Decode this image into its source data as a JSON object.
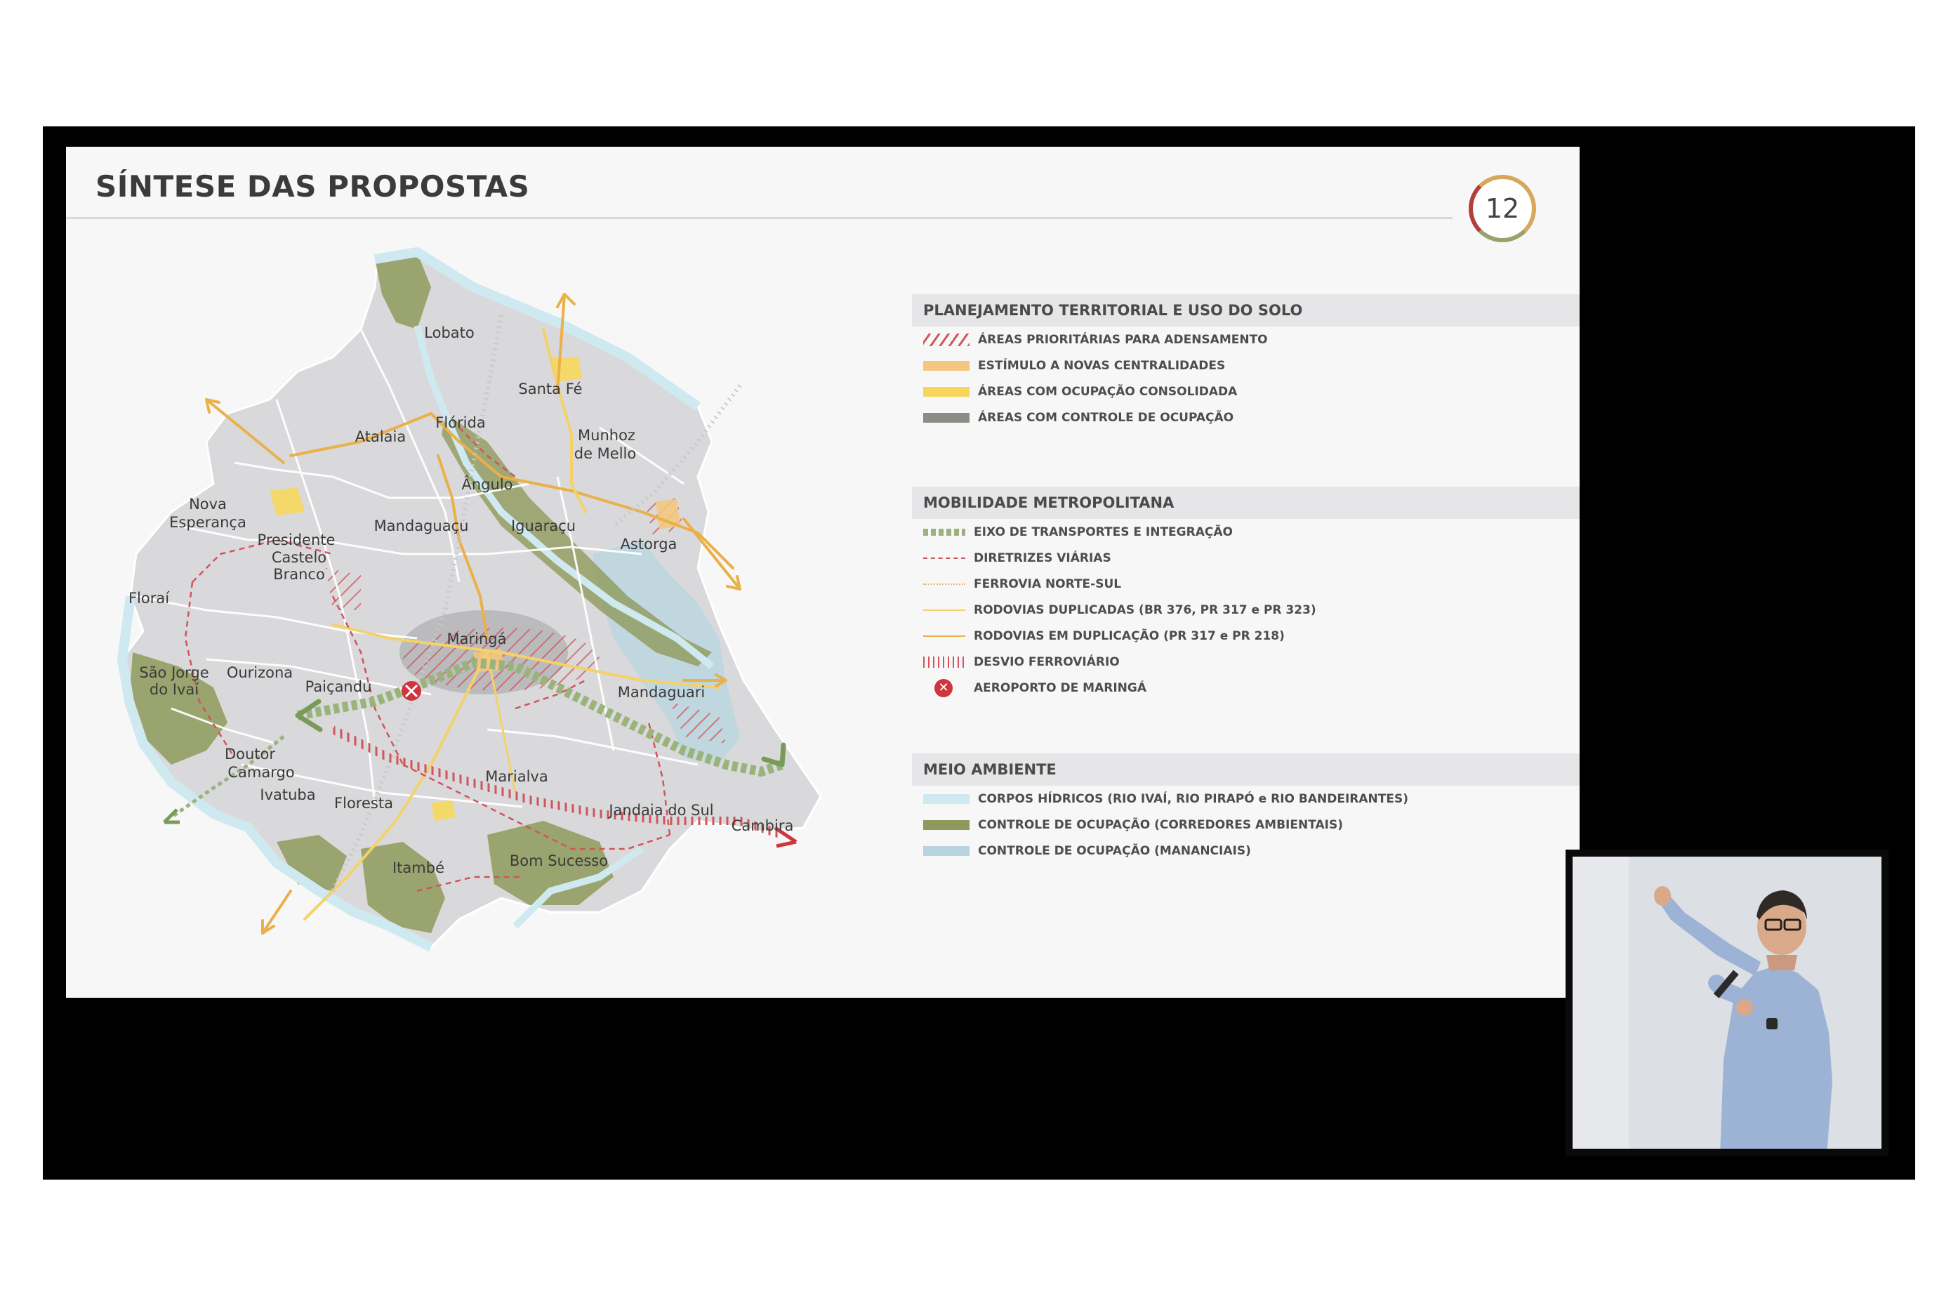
{
  "slide": {
    "title": "SÍNTESE DAS PROPOSTAS",
    "page_number": "12"
  },
  "map": {
    "places": [
      {
        "name": "Lobato",
        "pos": [
          546,
          272
        ]
      },
      {
        "name": "Santa Fé",
        "pos": [
          690,
          352
        ]
      },
      {
        "name": "Flórida",
        "pos": [
          562,
          400
        ]
      },
      {
        "name": "Atalaia",
        "pos": [
          448,
          420
        ]
      },
      {
        "name": "Munhoz",
        "pos": [
          770,
          418
        ]
      },
      {
        "name": "de Mello",
        "pos": [
          768,
          444
        ]
      },
      {
        "name": "Ângulo",
        "pos": [
          600,
          488
        ]
      },
      {
        "name": "Nova",
        "pos": [
          202,
          516
        ]
      },
      {
        "name": "Esperança",
        "pos": [
          202,
          542
        ]
      },
      {
        "name": "Mandaguaçu",
        "pos": [
          506,
          547
        ]
      },
      {
        "name": "Iguaraçu",
        "pos": [
          680,
          547
        ]
      },
      {
        "name": "Presidente",
        "pos": [
          328,
          567
        ]
      },
      {
        "name": "Castelo",
        "pos": [
          332,
          592
        ]
      },
      {
        "name": "Branco",
        "pos": [
          332,
          616
        ]
      },
      {
        "name": "Astorga",
        "pos": [
          830,
          573
        ]
      },
      {
        "name": "Floraí",
        "pos": [
          118,
          650
        ]
      },
      {
        "name": "Maringá",
        "pos": [
          585,
          708
        ]
      },
      {
        "name": "São Jorge",
        "pos": [
          154,
          756
        ]
      },
      {
        "name": "do Ivaí",
        "pos": [
          154,
          780
        ]
      },
      {
        "name": "Ourizona",
        "pos": [
          276,
          756
        ]
      },
      {
        "name": "Paiçandu",
        "pos": [
          388,
          776
        ]
      },
      {
        "name": "Mandaguari",
        "pos": [
          848,
          784
        ]
      },
      {
        "name": "Doutor",
        "pos": [
          262,
          872
        ]
      },
      {
        "name": "Camargo",
        "pos": [
          278,
          898
        ]
      },
      {
        "name": "Marialva",
        "pos": [
          642,
          904
        ]
      },
      {
        "name": "Ivatuba",
        "pos": [
          316,
          930
        ]
      },
      {
        "name": "Floresta",
        "pos": [
          424,
          942
        ]
      },
      {
        "name": "Jandaia do Sul",
        "pos": [
          848,
          952
        ]
      },
      {
        "name": "Cambira",
        "pos": [
          992,
          974
        ]
      },
      {
        "name": "Bom Sucesso",
        "pos": [
          702,
          1024
        ]
      },
      {
        "name": "Itambé",
        "pos": [
          502,
          1034
        ]
      }
    ]
  },
  "legend": {
    "sections": [
      {
        "title": "PLANEJAMENTO TERRITORIAL E USO DO SOLO",
        "items": [
          {
            "label": "ÁREAS PRIORITÁRIAS PARA ADENSAMENTO",
            "swatch": "hatch",
            "color": "#d0555b"
          },
          {
            "label": "ESTÍMULO A NOVAS CENTRALIDADES",
            "swatch": "fill",
            "color": "#f3c77f"
          },
          {
            "label": "ÁREAS COM OCUPAÇÃO CONSOLIDADA",
            "swatch": "fill",
            "color": "#f6d75c"
          },
          {
            "label": "ÁREAS COM CONTROLE DE OCUPAÇÃO",
            "swatch": "fill",
            "color": "#8a8c86"
          }
        ]
      },
      {
        "title": "MOBILIDADE METROPOLITANA",
        "items": [
          {
            "label": "EIXO DE TRANSPORTES E INTEGRAÇÃO",
            "swatch": "dash-thick",
            "color": "#9ab37a"
          },
          {
            "label": "DIRETRIZES VIÁRIAS",
            "swatch": "dash-thin",
            "color": "#d0555b"
          },
          {
            "label": "FERROVIA NORTE-SUL",
            "swatch": "dot",
            "color": "#e8b37a"
          },
          {
            "label": "RODOVIAS DUPLICADAS (BR 376, PR 317 e PR 323)",
            "swatch": "line",
            "color": "#f3d26a"
          },
          {
            "label": "RODOVIAS EM DUPLICAÇÃO (PR 317 e PR 218)",
            "swatch": "line",
            "color": "#eab04a"
          },
          {
            "label": "DESVIO FERROVIÁRIO",
            "swatch": "bars",
            "color": "#d0555b"
          },
          {
            "label": "AEROPORTO DE MARINGÁ",
            "swatch": "airport",
            "color": "#d0343c"
          }
        ]
      },
      {
        "title": "MEIO AMBIENTE",
        "items": [
          {
            "label": "CORPOS HÍDRICOS (RIO IVAÍ, RIO PIRAPÓ e RIO BANDEIRANTES)",
            "swatch": "fill",
            "color": "#cfe9f0"
          },
          {
            "label": "CONTROLE DE OCUPAÇÃO (CORREDORES AMBIENTAIS)",
            "swatch": "fill",
            "color": "#8e9a5b"
          },
          {
            "label": "CONTROLE DE OCUPAÇÃO (MANANCIAIS)",
            "swatch": "fill",
            "color": "#b7d3df"
          }
        ]
      }
    ]
  }
}
